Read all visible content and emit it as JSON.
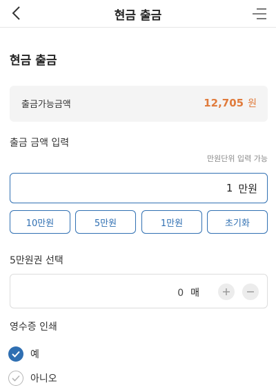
{
  "header": {
    "title": "현금 출금",
    "back_icon": "chevron-left-icon",
    "menu_icon": "menu-icon"
  },
  "section_title": "현금 출금",
  "available": {
    "label": "출금가능금액",
    "amount": "12,705",
    "unit": "원",
    "color": "#e07b3c"
  },
  "amount_input": {
    "label": "출금 금액 입력",
    "hint": "만원단위 입력 가능",
    "value": "1",
    "unit": "만원"
  },
  "quick_buttons": [
    "10만원",
    "5만원",
    "1만원",
    "초기화"
  ],
  "bill_select": {
    "label": "5만원권 선택",
    "count": "0",
    "unit": "매",
    "plus_icon": "plus-icon",
    "minus_icon": "minus-icon"
  },
  "receipt": {
    "label": "영수증 인쇄",
    "options": [
      {
        "label": "예",
        "checked": true
      },
      {
        "label": "아니오",
        "checked": false
      }
    ]
  },
  "colors": {
    "accent": "#2f6fb2",
    "highlight": "#e07b3c"
  }
}
